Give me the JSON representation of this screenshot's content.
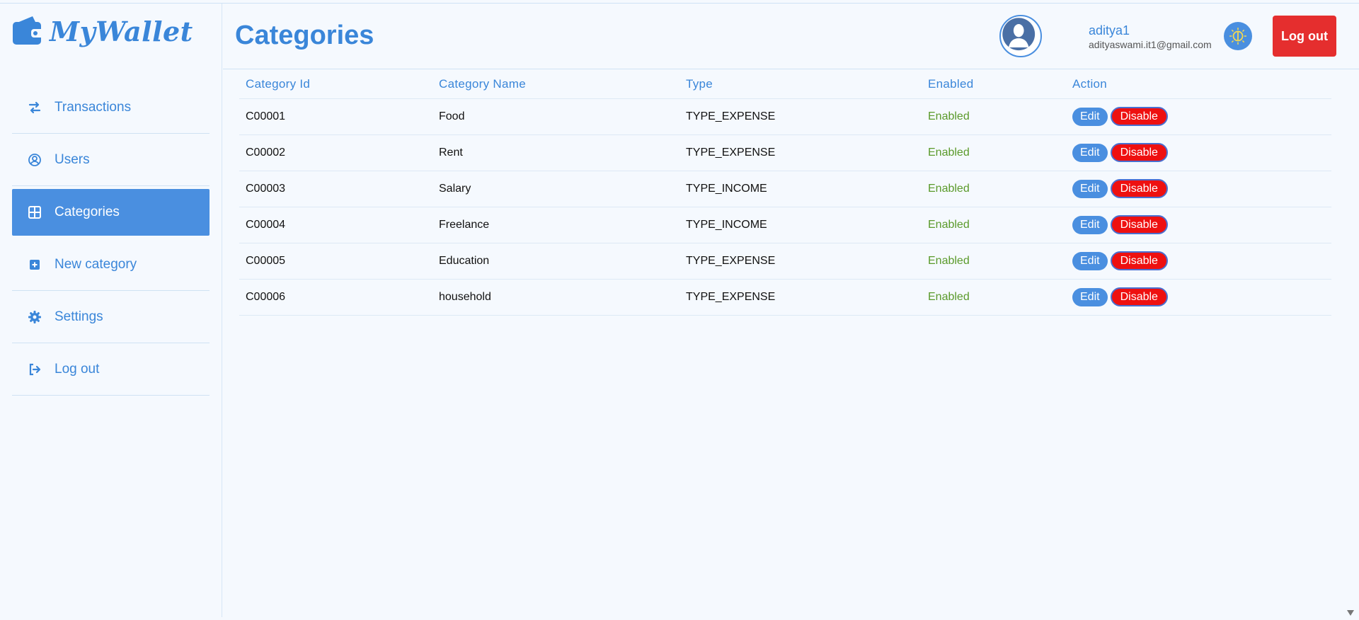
{
  "app": {
    "name": "MyWallet"
  },
  "colors": {
    "accent": "#3a86d9",
    "active_nav": "#4a8fe0",
    "danger": "#e52e2e",
    "enabled_text": "#5a9a2a"
  },
  "sidebar": {
    "items": [
      {
        "label": "Transactions",
        "icon": "arrows-exchange-icon",
        "active": false
      },
      {
        "label": "Users",
        "icon": "user-circle-icon",
        "active": false
      },
      {
        "label": "Categories",
        "icon": "grid-icon",
        "active": true
      },
      {
        "label": "New category",
        "icon": "plus-square-icon",
        "active": false
      },
      {
        "label": "Settings",
        "icon": "gear-icon",
        "active": false
      },
      {
        "label": "Log out",
        "icon": "sign-out-icon",
        "active": false
      }
    ]
  },
  "header": {
    "title": "Categories",
    "user_name": "aditya1",
    "user_email": "adityaswami.it1@gmail.com",
    "logout_label": "Log out"
  },
  "table": {
    "columns": [
      "Category Id",
      "Category Name",
      "Type",
      "Enabled",
      "Action"
    ],
    "rows": [
      {
        "id": "C00001",
        "name": "Food",
        "type": "TYPE_EXPENSE",
        "enabled": "Enabled"
      },
      {
        "id": "C00002",
        "name": "Rent",
        "type": "TYPE_EXPENSE",
        "enabled": "Enabled"
      },
      {
        "id": "C00003",
        "name": "Salary",
        "type": "TYPE_INCOME",
        "enabled": "Enabled"
      },
      {
        "id": "C00004",
        "name": "Freelance",
        "type": "TYPE_INCOME",
        "enabled": "Enabled"
      },
      {
        "id": "C00005",
        "name": "Education",
        "type": "TYPE_EXPENSE",
        "enabled": "Enabled"
      },
      {
        "id": "C00006",
        "name": "household",
        "type": "TYPE_EXPENSE",
        "enabled": "Enabled"
      }
    ],
    "edit_label": "Edit",
    "disable_label": "Disable"
  }
}
